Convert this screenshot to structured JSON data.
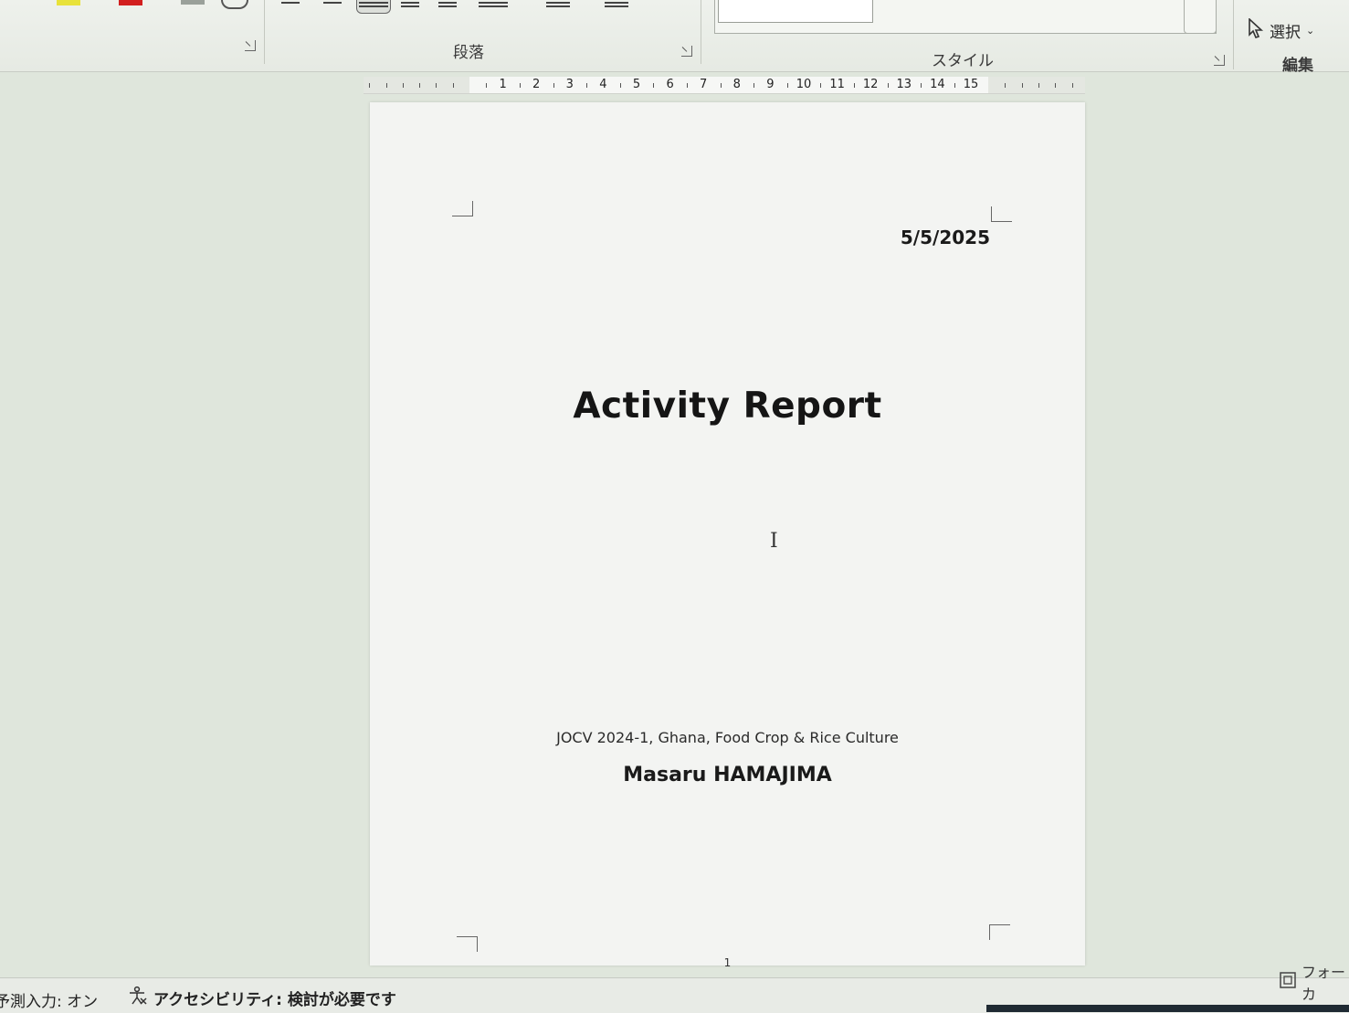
{
  "ribbon": {
    "paragraph_group_label": "段落",
    "styles_group_label": "スタイル",
    "editing_group_label": "編集",
    "select_label": "選択",
    "colors": {
      "highlight": "#e8e23a",
      "font_color": "#d21f1f",
      "accent_blue": "#2f6fd6"
    }
  },
  "ruler": {
    "numbers": [
      "1",
      "2",
      "3",
      "4",
      "5",
      "6",
      "7",
      "8",
      "9",
      "10",
      "11",
      "12",
      "13",
      "14",
      "15"
    ]
  },
  "document": {
    "date": "5/5/2025",
    "title": "Activity Report",
    "subtitle": "JOCV 2024-1, Ghana, Food Crop & Rice Culture",
    "author": "Masaru HAMAJIMA",
    "page_number": "1"
  },
  "statusbar": {
    "predictive_input": "予測入力: オン",
    "accessibility": "アクセシビリティ: 検討が必要です",
    "focus": "フォーカ"
  },
  "icons": [
    "paragraph-launcher-icon",
    "styles-launcher-icon",
    "font-launcher-icon",
    "cursor-arrow-icon",
    "chevron-down-icon",
    "accessibility-icon",
    "focus-mode-icon",
    "text-cursor-icon"
  ]
}
